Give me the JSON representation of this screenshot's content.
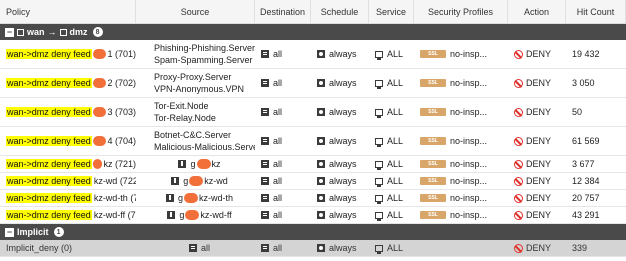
{
  "columns": [
    "Policy",
    "Source",
    "Destination",
    "Schedule",
    "Service",
    "Security Profiles",
    "Action",
    "Hit Count"
  ],
  "section_wan": {
    "toggle": "−",
    "from": "wan",
    "arrow": "→",
    "to": "dmz",
    "count": "8"
  },
  "section_implicit": {
    "toggle": "−",
    "label": "Implicit",
    "count": "1"
  },
  "rows": [
    {
      "policy_prefix": "wan->dmz deny feed",
      "policy_suffix": "1 (701)",
      "src1": "Phishing-Phishing.Server",
      "src2": "Spam-Spamming.Server",
      "dst": "all",
      "sched": "always",
      "svc": "ALL",
      "ssl": "SSL",
      "profile": "no-insp...",
      "action": "DENY",
      "hits": "19 432"
    },
    {
      "policy_prefix": "wan->dmz deny feed",
      "policy_suffix": "2 (702)",
      "src1": "Proxy-Proxy.Server",
      "src2": "VPN-Anonymous.VPN",
      "dst": "all",
      "sched": "always",
      "svc": "ALL",
      "ssl": "SSL",
      "profile": "no-insp...",
      "action": "DENY",
      "hits": "3 050"
    },
    {
      "policy_prefix": "wan->dmz deny feed",
      "policy_suffix": "3 (703)",
      "src1": "Tor-Exit.Node",
      "src2": "Tor-Relay.Node",
      "dst": "all",
      "sched": "always",
      "svc": "ALL",
      "ssl": "SSL",
      "profile": "no-insp...",
      "action": "DENY",
      "hits": "50"
    },
    {
      "policy_prefix": "wan->dmz deny feed",
      "policy_suffix": "4 (704)",
      "src1": "Botnet-C&C.Server",
      "src2": "Malicious-Malicious.Server",
      "dst": "all",
      "sched": "always",
      "svc": "ALL",
      "ssl": "SSL",
      "profile": "no-insp...",
      "action": "DENY",
      "hits": "61 569"
    }
  ],
  "rows_single": [
    {
      "policy_prefix": "wan->dmz deny feed",
      "policy_suffix": "kz (721)",
      "src_a": "g",
      "src_b": "kz",
      "dst": "all",
      "sched": "always",
      "svc": "ALL",
      "ssl": "SSL",
      "profile": "no-insp...",
      "action": "DENY",
      "hits": "3 677"
    },
    {
      "policy_prefix": "wan->dmz deny feed",
      "policy_suffix": "kz-wd (722)",
      "src_a": "g",
      "src_b": "kz-wd",
      "dst": "all",
      "sched": "always",
      "svc": "ALL",
      "ssl": "SSL",
      "profile": "no-insp...",
      "action": "DENY",
      "hits": "12 384"
    },
    {
      "policy_prefix": "wan->dmz deny feed",
      "policy_suffix": "kz-wd-th (723)",
      "src_a": "g",
      "src_b": "kz-wd-th",
      "dst": "all",
      "sched": "always",
      "svc": "ALL",
      "ssl": "SSL",
      "profile": "no-insp...",
      "action": "DENY",
      "hits": "20 757"
    },
    {
      "policy_prefix": "wan->dmz deny feed",
      "policy_suffix": "kz-wd-ff (724)",
      "src_a": "g",
      "src_b": "kz-wd-ff",
      "dst": "all",
      "sched": "always",
      "svc": "ALL",
      "ssl": "SSL",
      "profile": "no-insp...",
      "action": "DENY",
      "hits": "43 291"
    }
  ],
  "implicit_row": {
    "policy": "Implicit_deny (0)",
    "src": "all",
    "dst": "all",
    "sched": "always",
    "svc": "ALL",
    "action": "DENY",
    "hits": "339"
  },
  "colors": {
    "highlight": "#ffff00",
    "redaction": "#f36f3a",
    "section_bg": "#4a4a4a",
    "deny": "#e0302a",
    "ssl": "#d9a66a"
  }
}
